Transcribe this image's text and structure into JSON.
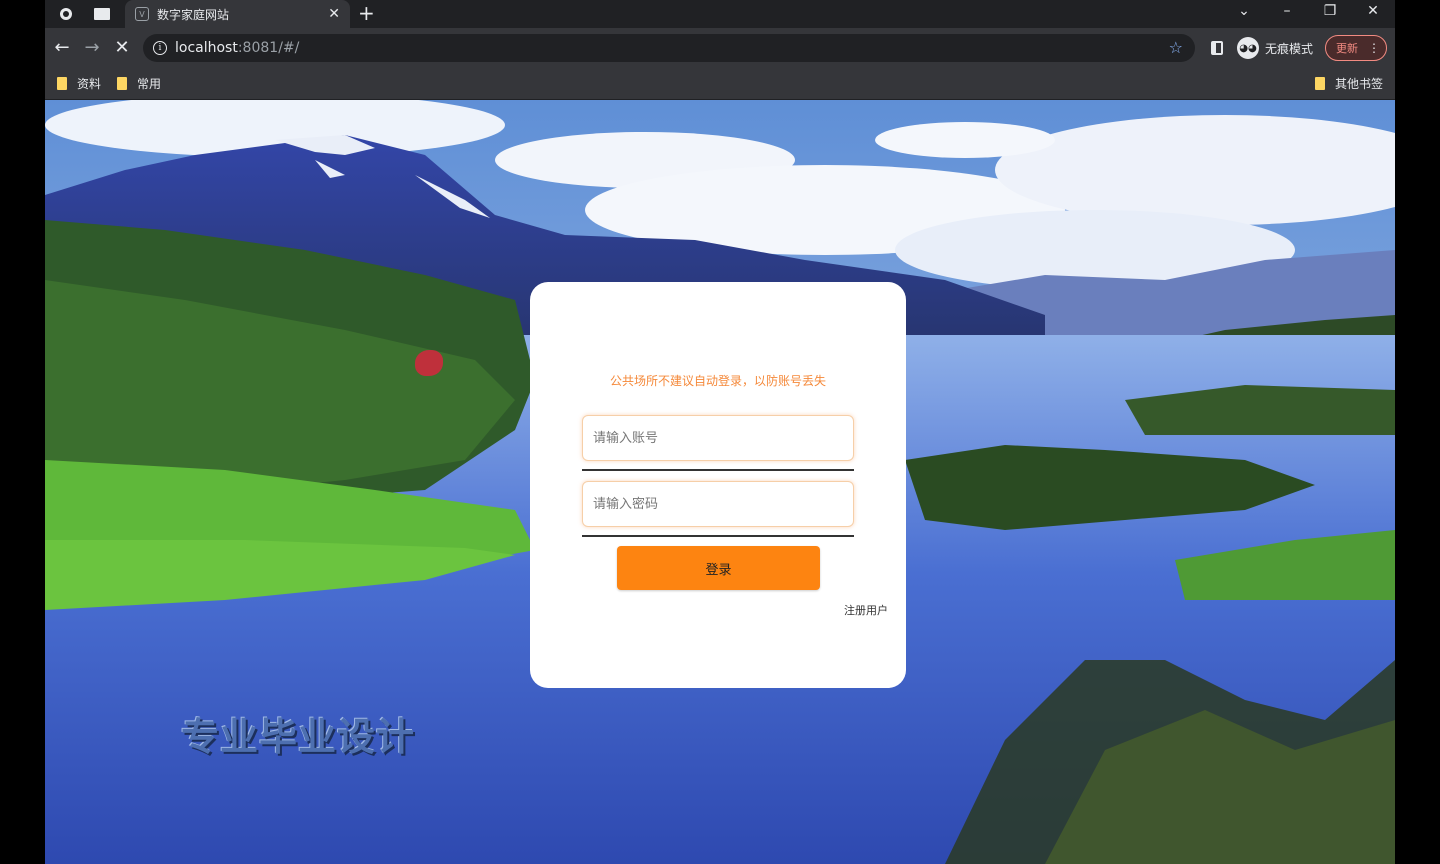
{
  "browser": {
    "tab": {
      "title": "数字家庭网站"
    },
    "address": {
      "host": "localhost",
      "rest": ":8081/#/"
    },
    "incognito_label": "无痕模式",
    "update_label": "更新",
    "bookmarks": [
      {
        "label": "资料"
      },
      {
        "label": "常用"
      }
    ],
    "other_bookmarks_label": "其他书签"
  },
  "login": {
    "notice": "公共场所不建议自动登录，以防账号丢失",
    "account_placeholder": "请输入账号",
    "password_placeholder": "请输入密码",
    "submit_label": "登录",
    "register_label": "注册用户"
  },
  "page": {
    "watermark": "专业毕业设计"
  },
  "colors": {
    "accent": "#fd8411",
    "notice": "#f5893a"
  }
}
